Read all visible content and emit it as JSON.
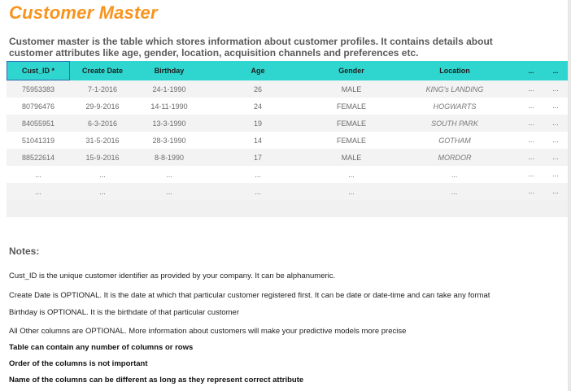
{
  "title": "Customer Master",
  "description": "Customer master is the table which stores information about customer profiles. It contains details about customer attributes like age, gender, location, acquisition channels and preferences etc.",
  "table": {
    "headers": [
      "Cust_ID *",
      "Create Date",
      "Birthday",
      "Age",
      "Gender",
      "Location",
      "...",
      "..."
    ],
    "rows": [
      [
        "75953383",
        "7-1-2016",
        "24-1-1990",
        "26",
        "MALE",
        "KING's LANDING",
        "...",
        "..."
      ],
      [
        "80796476",
        "29-9-2016",
        "14-11-1990",
        "24",
        "FEMALE",
        "HOGWARTS",
        "...",
        "..."
      ],
      [
        "84055951",
        "6-3-2016",
        "13-3-1990",
        "19",
        "FEMALE",
        "SOUTH PARK",
        "...",
        "..."
      ],
      [
        "51041319",
        "31-5-2016",
        "28-3-1990",
        "14",
        "FEMALE",
        "GOTHAM",
        "...",
        "..."
      ],
      [
        "88522614",
        "15-9-2016",
        "8-8-1990",
        "17",
        "MALE",
        "MORDOR",
        "...",
        "..."
      ],
      [
        "...",
        "...",
        "...",
        "...",
        "...",
        "...",
        "...",
        "..."
      ],
      [
        "...",
        "...",
        "...",
        "...",
        "...",
        "...",
        "...",
        "..."
      ]
    ]
  },
  "notes": {
    "heading": "Notes:",
    "lines": [
      "Cust_ID is the unique customer identifier as provided by your company. It can be alphanumeric.",
      "Create Date is OPTIONAL. It is the date at which that particular customer registered first. It can be date or date-time and can take any format",
      "Birthday is OPTIONAL. It is the birthdate of that particular customer",
      "All Other columns are OPTIONAL. More information about customers will make your predictive models more precise",
      "Table can contain any number of columns or rows",
      "Order of the columns is not important",
      "Name of the columns can be different as long as they represent correct attribute"
    ]
  },
  "colors": {
    "title": "#f7941d",
    "header_bg": "#2fd6cf",
    "row_alt": "#f3f3f3"
  }
}
